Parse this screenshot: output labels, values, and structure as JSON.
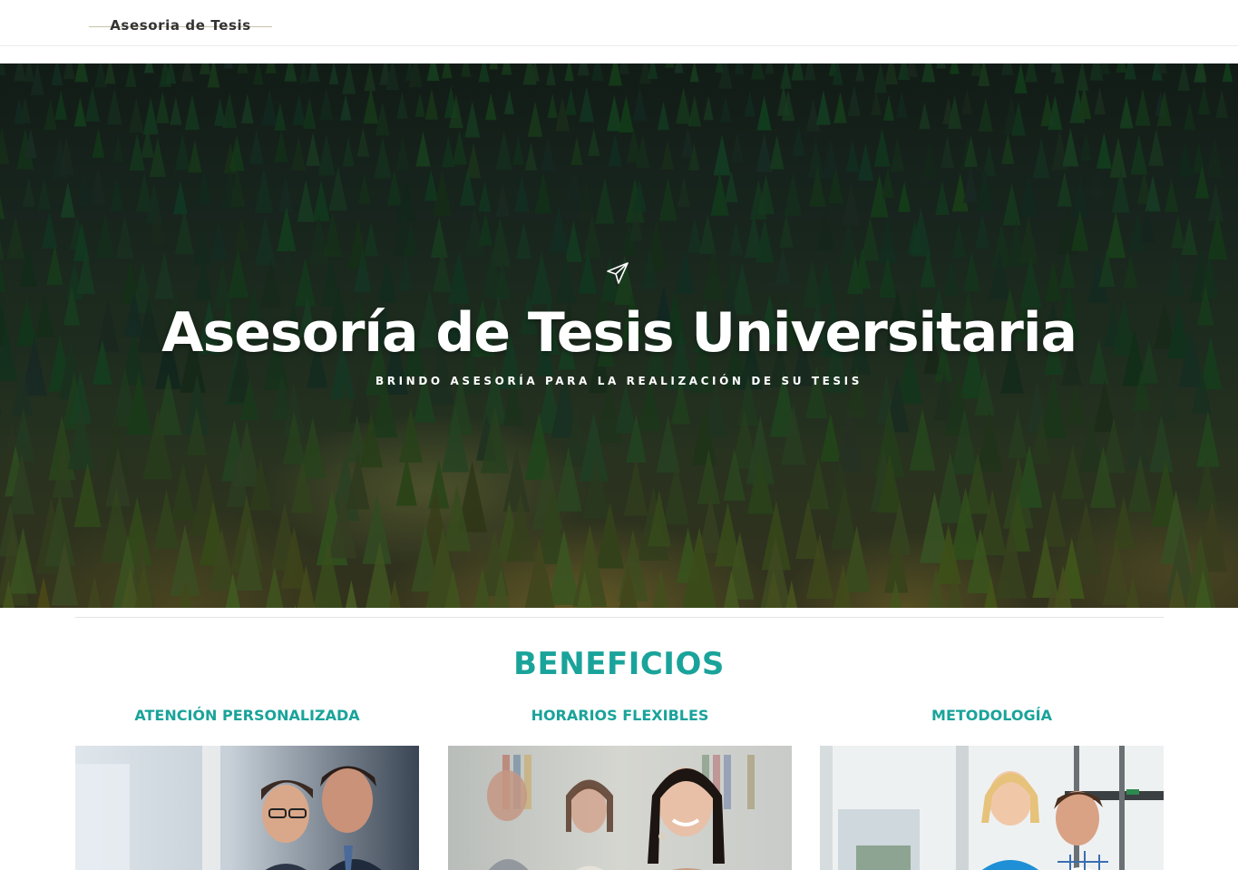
{
  "header": {
    "brand": "Asesoria de Tesis"
  },
  "hero": {
    "icon": "send-icon",
    "title": "Asesoría de Tesis Universitaria",
    "subtitle": "BRINDO ASESORÍA PARA LA REALIZACIÓN DE SU TESIS"
  },
  "benefits": {
    "title": "BENEFICIOS",
    "items": [
      {
        "label": "ATENCIÓN PERSONALIZADA"
      },
      {
        "label": "HORARIOS FLEXIBLES"
      },
      {
        "label": "METODOLOGÍA"
      }
    ]
  },
  "colors": {
    "accent": "#1aa39a",
    "forest_dark": "#1c2b22"
  }
}
